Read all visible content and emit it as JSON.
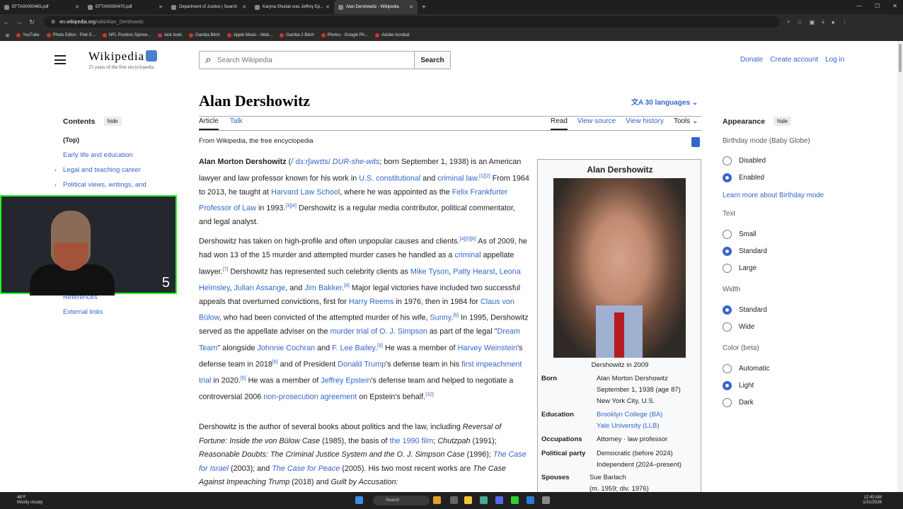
{
  "browser": {
    "tabs": [
      {
        "label": "EFTA00000465.pdf",
        "active": false
      },
      {
        "label": "EFTA00000470.pdf",
        "active": false
      },
      {
        "label": "Department of Justice | Search",
        "active": false
      },
      {
        "label": "Karyna Shuliak was Jeffrey Ep...",
        "active": false
      },
      {
        "label": "Alan Dershowitz - Wikipedia",
        "active": true
      }
    ],
    "url_host": "en.wikipedia.org",
    "url_path": "/wiki/Alan_Dershowitz",
    "bookmarks": [
      "YouTube",
      "Photo Editor : Pixlr E...",
      "NFL Position Spinne...",
      "kick tools",
      "Gamba Bitch",
      "Apple Music - Web...",
      "Gamba 2 Bitch",
      "Photos - Google Ph...",
      "Adobe Acrobat"
    ]
  },
  "header": {
    "logo": "Wikipedia",
    "tagline": "25 years of the free encyclopedia",
    "search_placeholder": "Search Wikipedia",
    "search_button": "Search",
    "donate": "Donate",
    "create_account": "Create account",
    "log_in": "Log in"
  },
  "toc": {
    "title": "Contents",
    "hide": "hide",
    "items": [
      "(Top)",
      "Early life and education",
      "Legal and teaching career",
      "Political views, writings, and commentary",
      "References",
      "External links"
    ]
  },
  "webcam": {
    "number": "5"
  },
  "article": {
    "title": "Alan Dershowitz",
    "languages": "30 languages",
    "tab_article": "Article",
    "tab_talk": "Talk",
    "tab_read": "Read",
    "tab_source": "View source",
    "tab_history": "View history",
    "tab_tools": "Tools",
    "from": "From Wikipedia, the free encyclopedia"
  },
  "infobox": {
    "title": "Alan Dershowitz",
    "caption": "Dershowitz in 2009",
    "rows": [
      {
        "k": "Born",
        "v": "Alan Morton Dershowitz\nSeptember 1, 1938 (age 87)\nNew York City, U.S."
      },
      {
        "k": "Education",
        "v": "Brooklyn College (BA)\nYale University (LLB)"
      },
      {
        "k": "Occupations",
        "v": "Attorney · law professor"
      },
      {
        "k": "Political party",
        "v": "Democratic (before 2024)\nIndependent (2024–present)"
      },
      {
        "k": "Spouses",
        "v": "Sue Barlach\n(m. 1959; div. 1976)"
      }
    ]
  },
  "appearance": {
    "title": "Appearance",
    "hide": "hide",
    "birthday_label": "Birthday mode (Baby Globe)",
    "disabled": "Disabled",
    "enabled": "Enabled",
    "learn_more": "Learn more about Birthday mode",
    "text_label": "Text",
    "small": "Small",
    "standard": "Standard",
    "large": "Large",
    "width_label": "Width",
    "w_standard": "Standard",
    "wide": "Wide",
    "color_label": "Color (beta)",
    "automatic": "Automatic",
    "light": "Light",
    "dark": "Dark"
  },
  "taskbar": {
    "weather_temp": "48°F",
    "weather_desc": "Mostly cloudy",
    "search": "Search",
    "time": "12:40 AM",
    "date": "1/31/2026"
  }
}
